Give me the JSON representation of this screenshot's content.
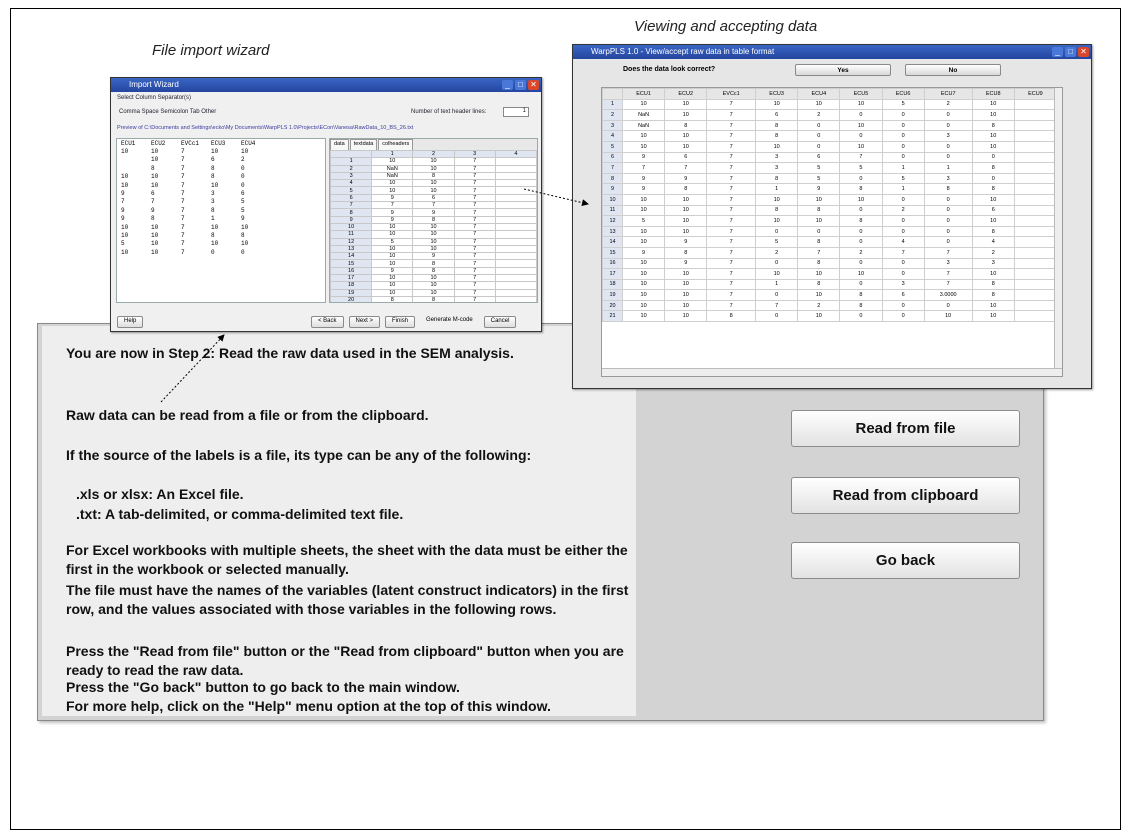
{
  "captions": {
    "wizard": "File import wizard",
    "viewer": "Viewing and accepting data"
  },
  "main": {
    "paragraphs": [
      "You are now in Step 2: Read the raw data used in the SEM analysis.",
      "Raw data can be read from a file or from the clipboard.",
      "If the source of the labels is a file, its type can be any of the following:",
      ".xls or xlsx: An Excel file.",
      ".txt: A tab-delimited, or comma-delimited text file.",
      "For Excel workbooks with multiple sheets, the sheet with the data must be either the first in the workbook or selected manually.",
      "The file must have the names of the variables (latent construct indicators) in the first row, and the values associated with those variables in the following rows.",
      "Press the \"Read from file\" button or the \"Read from clipboard\" button when you are ready to read the raw data.",
      "Press the \"Go back\" button to go back to the main window.",
      "For more help, click on the \"Help\" menu option at the top of this window."
    ],
    "buttons": {
      "read_file": "Read from file",
      "read_clipboard": "Read from clipboard",
      "go_back": "Go back"
    }
  },
  "wizard": {
    "title": "Import Wizard",
    "select_label": "Select Column Separator(s)",
    "separators": "Comma   Space   Semicolon   Tab   Other",
    "header_lines_label": "Number of text header lines:",
    "header_lines_value": "1",
    "preview_path": "Preview of C:\\Documents and Settings\\ecko\\My Documents\\WarpPLS 1.0\\Projects\\ECon\\Vanesa\\RawData_10_BS_26.txt",
    "preview_header": [
      "ECU1",
      "ECU2",
      "EVCc1",
      "ECU3",
      "ECU4"
    ],
    "preview_rows": [
      [
        "10",
        "10",
        "7",
        "10",
        "10"
      ],
      [
        "",
        "10",
        "7",
        "6",
        "2"
      ],
      [
        "",
        "8",
        "7",
        "8",
        "0"
      ],
      [
        "10",
        "10",
        "7",
        "8",
        "0"
      ],
      [
        "10",
        "10",
        "7",
        "10",
        "0"
      ],
      [
        "9",
        "6",
        "7",
        "3",
        "6"
      ],
      [
        "7",
        "7",
        "7",
        "3",
        "5"
      ],
      [
        "9",
        "9",
        "7",
        "8",
        "5"
      ],
      [
        "9",
        "8",
        "7",
        "1",
        "9"
      ],
      [
        "10",
        "10",
        "7",
        "10",
        "10"
      ],
      [
        "10",
        "10",
        "7",
        "8",
        "8"
      ],
      [
        "5",
        "10",
        "7",
        "10",
        "10"
      ],
      [
        "10",
        "10",
        "7",
        "0",
        "0"
      ]
    ],
    "sheet_tabs": [
      "data",
      "textdata",
      "colheaders"
    ],
    "sheet_cols": [
      "1",
      "2",
      "3",
      "4"
    ],
    "sheet_rows": [
      [
        "1",
        "10",
        "10",
        "7"
      ],
      [
        "2",
        "NaN",
        "10",
        "7"
      ],
      [
        "3",
        "NaN",
        "8",
        "7"
      ],
      [
        "4",
        "10",
        "10",
        "7"
      ],
      [
        "5",
        "10",
        "10",
        "7"
      ],
      [
        "6",
        "9",
        "6",
        "7"
      ],
      [
        "7",
        "7",
        "7",
        "7"
      ],
      [
        "8",
        "9",
        "9",
        "7"
      ],
      [
        "9",
        "9",
        "8",
        "7"
      ],
      [
        "10",
        "10",
        "10",
        "7"
      ],
      [
        "11",
        "10",
        "10",
        "7"
      ],
      [
        "12",
        "5",
        "10",
        "7"
      ],
      [
        "13",
        "10",
        "10",
        "7"
      ],
      [
        "14",
        "10",
        "9",
        "7"
      ],
      [
        "15",
        "10",
        "8",
        "7"
      ],
      [
        "16",
        "9",
        "8",
        "7"
      ],
      [
        "17",
        "10",
        "10",
        "7"
      ],
      [
        "18",
        "10",
        "10",
        "7"
      ],
      [
        "19",
        "10",
        "10",
        "7"
      ],
      [
        "20",
        "8",
        "8",
        "7"
      ]
    ],
    "btn_help": "Help",
    "btn_back": "< Back",
    "btn_next": "Next >",
    "btn_finish": "Finish",
    "generate_mcode": "Generate M-code",
    "btn_cancel": "Cancel"
  },
  "viewer": {
    "title": "WarpPLS 1.0 - View/accept raw data in table format",
    "question": "Does the data look correct?",
    "yes": "Yes",
    "no": "No",
    "columns": [
      "",
      "ECU1",
      "ECU2",
      "EVCc1",
      "ECU3",
      "ECU4",
      "ECU5",
      "ECU6",
      "ECU7",
      "ECU8",
      "ECU9"
    ],
    "rows": [
      [
        "1",
        "10",
        "10",
        "7",
        "10",
        "10",
        "10",
        "5",
        "2",
        "10"
      ],
      [
        "2",
        "NaN",
        "10",
        "7",
        "6",
        "2",
        "0",
        "0",
        "0",
        "10"
      ],
      [
        "3",
        "NaN",
        "8",
        "7",
        "8",
        "0",
        "10",
        "0",
        "0",
        "8"
      ],
      [
        "4",
        "10",
        "10",
        "7",
        "8",
        "0",
        "0",
        "0",
        "3",
        "10"
      ],
      [
        "5",
        "10",
        "10",
        "7",
        "10",
        "0",
        "10",
        "0",
        "0",
        "10"
      ],
      [
        "6",
        "9",
        "6",
        "7",
        "3",
        "6",
        "7",
        "0",
        "0",
        "0"
      ],
      [
        "7",
        "7",
        "7",
        "7",
        "3",
        "5",
        "5",
        "1",
        "1",
        "8"
      ],
      [
        "8",
        "9",
        "9",
        "7",
        "8",
        "5",
        "0",
        "5",
        "3",
        "0"
      ],
      [
        "9",
        "9",
        "8",
        "7",
        "1",
        "9",
        "8",
        "1",
        "8",
        "8"
      ],
      [
        "10",
        "10",
        "10",
        "7",
        "10",
        "10",
        "10",
        "0",
        "0",
        "10"
      ],
      [
        "11",
        "10",
        "10",
        "7",
        "8",
        "8",
        "0",
        "2",
        "0",
        "6"
      ],
      [
        "12",
        "5",
        "10",
        "7",
        "10",
        "10",
        "8",
        "0",
        "0",
        "10"
      ],
      [
        "13",
        "10",
        "10",
        "7",
        "0",
        "0",
        "0",
        "0",
        "0",
        "8"
      ],
      [
        "14",
        "10",
        "9",
        "7",
        "5",
        "8",
        "0",
        "4",
        "0",
        "4"
      ],
      [
        "15",
        "9",
        "8",
        "7",
        "2",
        "7",
        "2",
        "7",
        "7",
        "2"
      ],
      [
        "16",
        "10",
        "9",
        "7",
        "0",
        "8",
        "0",
        "0",
        "3",
        "3"
      ],
      [
        "17",
        "10",
        "10",
        "7",
        "10",
        "10",
        "10",
        "0",
        "7",
        "10"
      ],
      [
        "18",
        "10",
        "10",
        "7",
        "1",
        "8",
        "0",
        "3",
        "7",
        "8"
      ],
      [
        "19",
        "10",
        "10",
        "7",
        "0",
        "10",
        "8",
        "6",
        "3.0000",
        "8"
      ],
      [
        "20",
        "10",
        "10",
        "7",
        "7",
        "2",
        "8",
        "0",
        "0",
        "10"
      ],
      [
        "21",
        "10",
        "10",
        "8",
        "0",
        "10",
        "0",
        "0",
        "10",
        "10"
      ]
    ]
  }
}
